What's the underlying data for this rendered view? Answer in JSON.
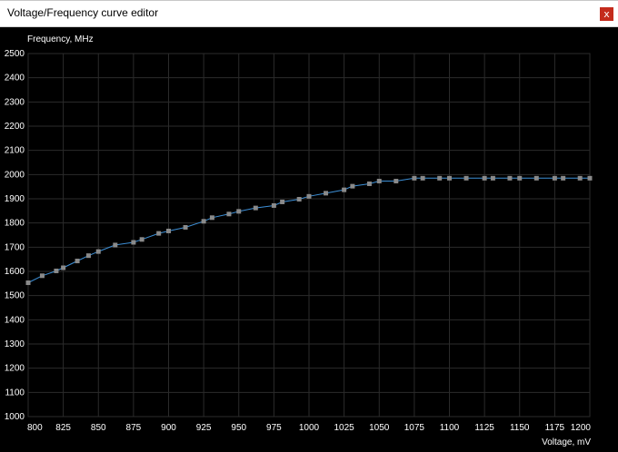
{
  "window": {
    "title": "Voltage/Frequency curve editor",
    "close_icon": "close-icon",
    "close_label": "x"
  },
  "colors": {
    "background": "#000000",
    "grid": "#2b2b2b",
    "curve": "#3d8fd6",
    "points": "#8a8a8a",
    "text": "#ffffff",
    "close_button": "#c42b1c"
  },
  "chart_data": {
    "type": "line",
    "ylabel": "Frequency, MHz",
    "xlabel": "Voltage, mV",
    "xlim": [
      800,
      1200
    ],
    "ylim": [
      1000,
      2500
    ],
    "grid": true,
    "x_ticks": [
      "800",
      "825",
      "850",
      "875",
      "900",
      "925",
      "950",
      "975",
      "1000",
      "1025",
      "1050",
      "1075",
      "1100",
      "1125",
      "1150",
      "1175",
      "1200"
    ],
    "y_ticks": [
      "1000",
      "1100",
      "1200",
      "1300",
      "1400",
      "1500",
      "1600",
      "1700",
      "1800",
      "1900",
      "2000",
      "2100",
      "2200",
      "2300",
      "2400",
      "2500"
    ],
    "series": [
      {
        "x": [
          800,
          810,
          820,
          825,
          835,
          843,
          850,
          862,
          875,
          881,
          893,
          900,
          912,
          925,
          931,
          943,
          950,
          962,
          975,
          981,
          993,
          1000,
          1012,
          1025,
          1031,
          1043,
          1050,
          1062,
          1075,
          1081,
          1093,
          1100,
          1112,
          1125,
          1131,
          1143,
          1150,
          1162,
          1175,
          1181,
          1193,
          1200
        ],
        "y": [
          1553,
          1582,
          1602,
          1615,
          1643,
          1665,
          1682,
          1709,
          1720,
          1732,
          1757,
          1767,
          1782,
          1807,
          1822,
          1837,
          1848,
          1862,
          1872,
          1887,
          1898,
          1910,
          1923,
          1937,
          1952,
          1962,
          1973,
          1973,
          1985,
          1985,
          1985,
          1985,
          1985,
          1985,
          1985,
          1985,
          1985,
          1985,
          1985,
          1985,
          1985,
          1985
        ]
      }
    ]
  }
}
